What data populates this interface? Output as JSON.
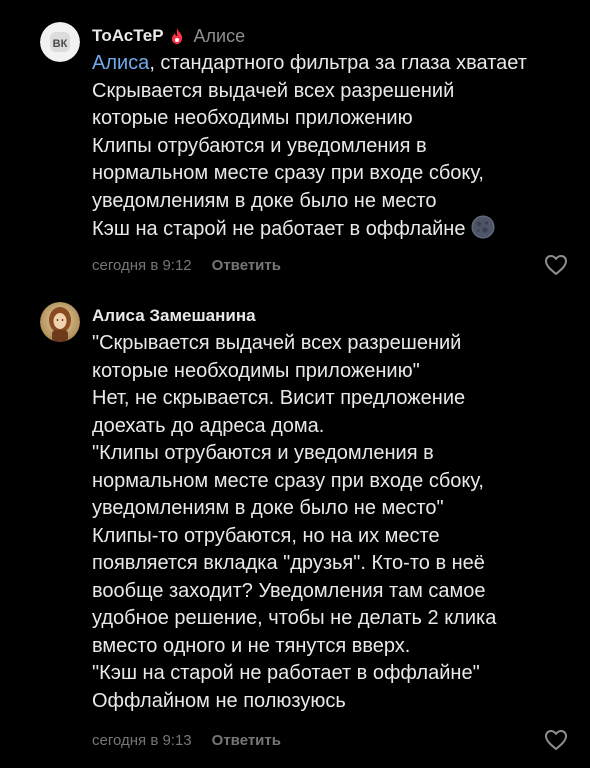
{
  "comments": [
    {
      "author": "ТоАсТеР",
      "reply_to": "Алисе",
      "mention": "Алиса",
      "lines": [
        ", стандартного фильтра за глаза хватает",
        "Скрывается выдачей всех разрешений",
        "которые необходимы приложению",
        "Клипы отрубаются и уведомления в",
        "нормальном месте сразу при входе сбоку,",
        "уведомлениям в доке было не место",
        "Кэш на старой не работает в оффлайне"
      ],
      "time": "сегодня в 9:12",
      "reply_label": "Ответить",
      "avatar_text": "ВК"
    },
    {
      "author": "Алиса Замешанина",
      "lines": [
        "\"Скрывается выдачей всех разрешений",
        "которые необходимы приложению\"",
        "Нет, не скрывается. Висит предложение",
        "доехать до адреса дома.",
        "\"Клипы отрубаются и уведомления в",
        "нормальном месте сразу при входе сбоку,",
        "уведомлениям в доке было не место\"",
        "Клипы-то отрубаются, но на их месте",
        "появляется вкладка \"друзья\". Кто-то в неё",
        "вообще заходит? Уведомления там самое",
        "удобное решение, чтобы не делать 2 клика",
        "вместо одного и не тянутся вверх.",
        "\"Кэш на старой не работает в оффлайне\"",
        "Оффлайном не полюзуюсь"
      ],
      "time": "сегодня в 9:13",
      "reply_label": "Ответить"
    }
  ],
  "icons": {
    "flame": "flame-icon",
    "moon": "new-moon-emoji",
    "like": "heart-outline-icon"
  },
  "colors": {
    "background": "#000000",
    "text": "#e9e9e9",
    "muted": "#767676",
    "mention": "#71aaeb",
    "flame": "#ff3347"
  }
}
